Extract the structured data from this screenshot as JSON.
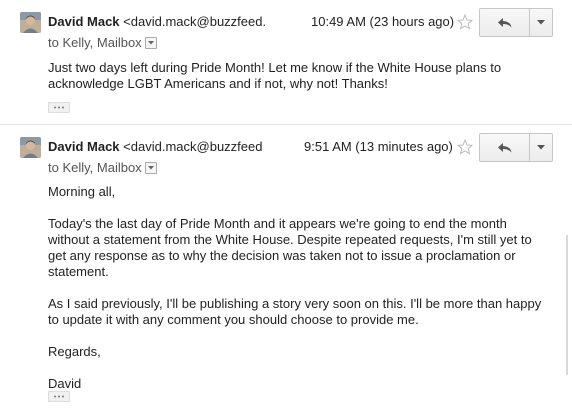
{
  "messages": [
    {
      "sender_name": "David Mack",
      "sender_email": "<david.mack@buzzfeed.com>",
      "timestamp": "10:49 AM (23 hours ago)",
      "to_line": "to Kelly, Mailbox",
      "body": [
        "Just two days left during Pride Month! Let me know if the White House plans to acknowledge LGBT Americans and if not, why not! Thanks!"
      ]
    },
    {
      "sender_name": "David Mack",
      "sender_email": "<david.mack@buzzfeed.com>",
      "timestamp": "9:51 AM (13 minutes ago)",
      "to_line": "to Kelly, Mailbox",
      "body": [
        "Morning all,",
        "Today's the last day of Pride Month and it appears we're going to end the month without a statement from the White House. Despite repeated requests, I'm still yet to get any response as to why the decision was taken not to issue a proclamation or statement.",
        "As I said previously, I'll be publishing a story very soon on this. I'll be more than happy to update it with any comment you should choose to provide me.",
        "Regards,",
        "David"
      ]
    }
  ],
  "icons": {
    "avatar": "avatar",
    "star": "star-icon",
    "reply": "reply-icon",
    "more": "chevron-down-icon",
    "details": "chevron-down-icon",
    "ellipsis": "ellipsis-icon"
  },
  "colors": {
    "text": "#222222",
    "muted": "#555555",
    "border": "#c6c6c6"
  }
}
